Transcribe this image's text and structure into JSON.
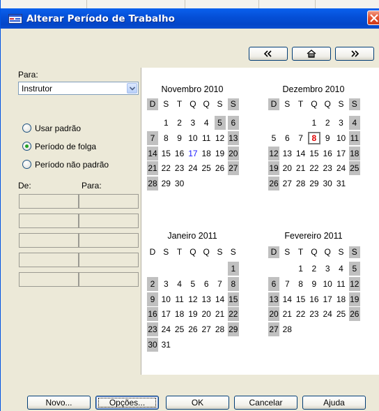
{
  "window": {
    "title": "Alterar Período de Trabalho",
    "title_color": "#ffffff",
    "titlebar_color": "#0550d8"
  },
  "nav": {
    "prev_icon": "double-chevron-left",
    "home_icon": "home",
    "next_icon": "double-chevron-right"
  },
  "left": {
    "para_label": "Para:",
    "combo_value": "Instrutor",
    "radios": [
      {
        "label": "Usar padrão",
        "checked": false
      },
      {
        "label": "Período de folga",
        "checked": true
      },
      {
        "label": "Período não padrão",
        "checked": false
      }
    ],
    "de_label": "De:",
    "para2_label": "Para:"
  },
  "calendar": {
    "weekday_headers": [
      "D",
      "S",
      "T",
      "Q",
      "Q",
      "S",
      "S"
    ],
    "months": [
      {
        "name": "Novembro 2010",
        "header_shaded": [
          true,
          false,
          false,
          false,
          false,
          false,
          true
        ],
        "weeks": [
          [
            "",
            "1",
            "2",
            "3",
            "4",
            "5",
            "6"
          ],
          [
            "7",
            "8",
            "9",
            "10",
            "11",
            "12",
            "13"
          ],
          [
            "14",
            "15",
            "16",
            "17",
            "18",
            "19",
            "20"
          ],
          [
            "21",
            "22",
            "23",
            "24",
            "25",
            "26",
            "27"
          ],
          [
            "28",
            "29",
            "30",
            "",
            "",
            "",
            ""
          ]
        ],
        "shaded": [
          [
            0,
            5
          ],
          [
            0,
            6
          ],
          [
            1,
            0
          ],
          [
            1,
            6
          ],
          [
            2,
            0
          ],
          [
            2,
            6
          ],
          [
            3,
            0
          ],
          [
            3,
            6
          ],
          [
            4,
            0
          ]
        ],
        "highlight": {
          "day": "17",
          "color": "#1a1aff"
        }
      },
      {
        "name": "Dezembro 2010",
        "header_shaded": [
          true,
          false,
          false,
          false,
          false,
          false,
          true
        ],
        "weeks": [
          [
            "",
            "",
            "",
            "1",
            "2",
            "3",
            "4"
          ],
          [
            "5",
            "6",
            "7",
            "8",
            "9",
            "10",
            "11"
          ],
          [
            "12",
            "13",
            "14",
            "15",
            "16",
            "17",
            "18"
          ],
          [
            "19",
            "20",
            "21",
            "22",
            "23",
            "24",
            "25"
          ],
          [
            "26",
            "27",
            "28",
            "29",
            "30",
            "31",
            ""
          ]
        ],
        "shaded": [
          [
            0,
            6
          ],
          [
            1,
            6
          ],
          [
            2,
            0
          ],
          [
            2,
            6
          ],
          [
            3,
            0
          ],
          [
            3,
            6
          ],
          [
            4,
            0
          ]
        ],
        "today": {
          "day": "8",
          "color": "#e00000"
        }
      },
      {
        "name": "Janeiro 2011",
        "header_shaded": [
          false,
          false,
          false,
          false,
          false,
          false,
          false
        ],
        "weeks": [
          [
            "",
            "",
            "",
            "",
            "",
            "",
            "1"
          ],
          [
            "2",
            "3",
            "4",
            "5",
            "6",
            "7",
            "8"
          ],
          [
            "9",
            "10",
            "11",
            "12",
            "13",
            "14",
            "15"
          ],
          [
            "16",
            "17",
            "18",
            "19",
            "20",
            "21",
            "22"
          ],
          [
            "23",
            "24",
            "25",
            "26",
            "27",
            "28",
            "29"
          ],
          [
            "30",
            "31",
            "",
            "",
            "",
            "",
            ""
          ]
        ],
        "shaded": [
          [
            0,
            6
          ],
          [
            1,
            0
          ],
          [
            1,
            6
          ],
          [
            2,
            0
          ],
          [
            2,
            6
          ],
          [
            3,
            0
          ],
          [
            3,
            6
          ],
          [
            4,
            0
          ],
          [
            4,
            6
          ],
          [
            5,
            0
          ]
        ]
      },
      {
        "name": "Fevereiro 2011",
        "header_shaded": [
          true,
          false,
          false,
          false,
          false,
          false,
          true
        ],
        "weeks": [
          [
            "",
            "",
            "1",
            "2",
            "3",
            "4",
            "5"
          ],
          [
            "6",
            "7",
            "8",
            "9",
            "10",
            "11",
            "12"
          ],
          [
            "13",
            "14",
            "15",
            "16",
            "17",
            "18",
            "19"
          ],
          [
            "20",
            "21",
            "22",
            "23",
            "24",
            "25",
            "26"
          ],
          [
            "27",
            "28",
            "",
            "",
            "",
            "",
            ""
          ]
        ],
        "shaded": [
          [
            0,
            6
          ],
          [
            1,
            0
          ],
          [
            1,
            6
          ],
          [
            2,
            0
          ],
          [
            2,
            6
          ],
          [
            3,
            0
          ],
          [
            3,
            6
          ],
          [
            4,
            0
          ]
        ]
      }
    ]
  },
  "buttons": {
    "novo": "Novo...",
    "opcoes": "Opções...",
    "ok": "OK",
    "cancelar": "Cancelar",
    "ajuda": "Ajuda"
  }
}
